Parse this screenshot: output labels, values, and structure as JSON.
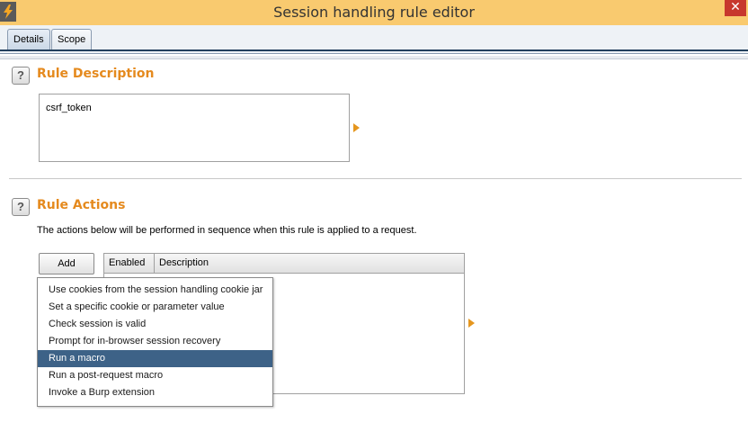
{
  "window": {
    "title": "Session handling rule editor",
    "close_label": "✕",
    "accent": "#f9ca6f"
  },
  "tabs": [
    {
      "label": "Details",
      "active": true
    },
    {
      "label": "Scope",
      "active": false
    }
  ],
  "rule_description": {
    "help_label": "?",
    "title": "Rule Description",
    "value": "csrf_token"
  },
  "rule_actions": {
    "help_label": "?",
    "title": "Rule Actions",
    "description": "The actions below will be performed in sequence when this rule is applied to a request.",
    "add_label": "Add",
    "columns": [
      "Enabled",
      "Description"
    ],
    "menu_items": [
      {
        "label": "Use cookies from the session handling cookie jar",
        "selected": false
      },
      {
        "label": "Set a specific cookie or parameter value",
        "selected": false
      },
      {
        "label": "Check session is valid",
        "selected": false
      },
      {
        "label": "Prompt for in-browser session recovery",
        "selected": false
      },
      {
        "label": "Run a macro",
        "selected": true
      },
      {
        "label": "Run a post-request macro",
        "selected": false
      },
      {
        "label": "Invoke a Burp extension",
        "selected": false
      }
    ]
  },
  "colors": {
    "section_title": "#e58a1e",
    "selected_item": "#3d6287",
    "arrow": "#e5961e"
  }
}
